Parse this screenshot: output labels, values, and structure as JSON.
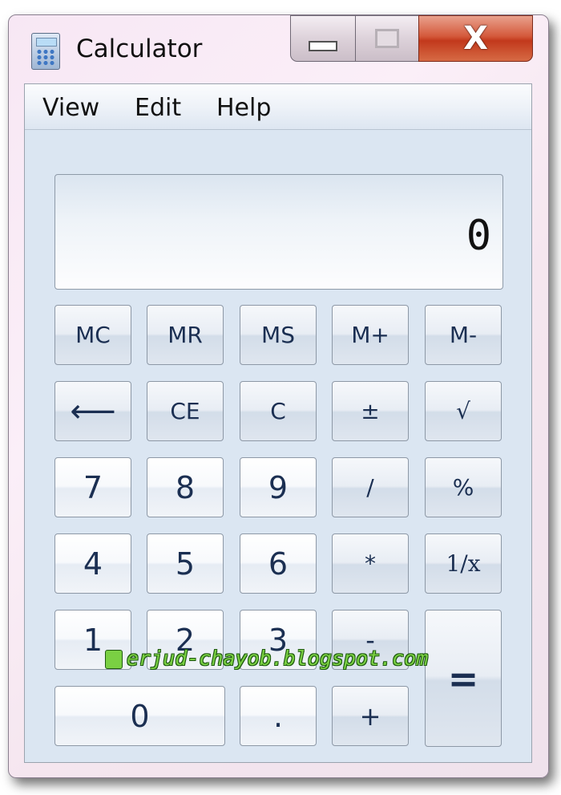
{
  "window": {
    "title": "Calculator",
    "close_glyph": "X",
    "icons": {
      "app": "calculator-icon",
      "minimize": "minimize-icon",
      "maximize": "maximize-icon",
      "close": "close-icon"
    }
  },
  "menu": [
    "View",
    "Edit",
    "Help"
  ],
  "display": {
    "value": "0"
  },
  "keys": {
    "mc": "MC",
    "mr": "MR",
    "ms": "MS",
    "mplus": "M+",
    "mminus": "M-",
    "backspace": "⟵",
    "ce": "CE",
    "c": "C",
    "plusminus": "±",
    "sqrt": "√",
    "n7": "7",
    "n8": "8",
    "n9": "9",
    "divide": "/",
    "percent": "%",
    "n4": "4",
    "n5": "5",
    "n6": "6",
    "multiply": "*",
    "reciprocal": "1/x",
    "n1": "1",
    "n2": "2",
    "n3": "3",
    "minus": "-",
    "equals": "=",
    "n0": "0",
    "decimal": ".",
    "plus": "+"
  },
  "watermark": "erjud-chayob.blogspot.com",
  "colors": {
    "close_button": "#c2391c",
    "client_bg": "#dbe6f2",
    "key_text": "#1b2f52",
    "watermark": "#7ad043"
  }
}
